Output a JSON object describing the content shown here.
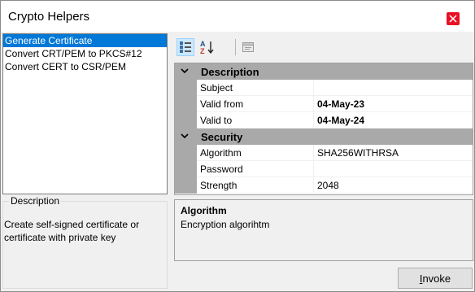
{
  "window": {
    "title": "Crypto Helpers"
  },
  "commands": [
    {
      "label": "Generate Certificate",
      "selected": true
    },
    {
      "label": "Convert CRT/PEM to PKCS#12",
      "selected": false
    },
    {
      "label": "Convert CERT to CSR/PEM",
      "selected": false
    }
  ],
  "description_box": {
    "legend": "Description",
    "text": "Create self-signed certificate or certificate with private key"
  },
  "toolbar": {
    "buttons": [
      {
        "name": "categorized-view-icon",
        "active": true
      },
      {
        "name": "alphabetical-sort-icon",
        "active": false
      },
      {
        "name": "property-pages-icon",
        "active": false
      }
    ]
  },
  "property_grid": {
    "categories": [
      {
        "name": "Description",
        "properties": [
          {
            "name": "Subject",
            "value": "",
            "bold": false
          },
          {
            "name": "Valid from",
            "value": "04-May-23",
            "bold": true
          },
          {
            "name": "Valid to",
            "value": "04-May-24",
            "bold": true
          }
        ]
      },
      {
        "name": "Security",
        "properties": [
          {
            "name": "Algorithm",
            "value": "SHA256WITHRSA",
            "bold": false
          },
          {
            "name": "Password",
            "value": "",
            "bold": false
          },
          {
            "name": "Strength",
            "value": "2048",
            "bold": false
          }
        ]
      }
    ]
  },
  "help": {
    "title": "Algorithm",
    "description": "Encryption algorihtm"
  },
  "invoke": {
    "label": "Invoke"
  },
  "colors": {
    "selection": "#0078d7",
    "close": "#e81123",
    "category_bg": "#a9a9a9"
  }
}
